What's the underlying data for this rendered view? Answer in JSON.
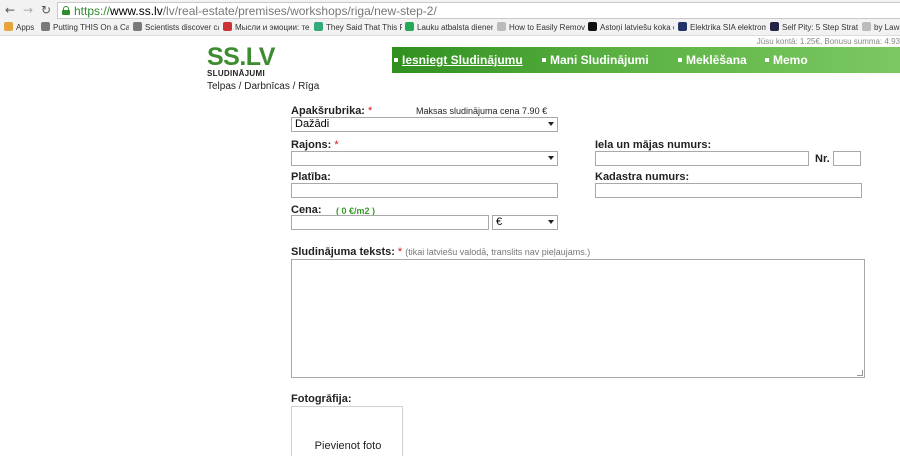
{
  "browser": {
    "url_scheme": "https://",
    "url_host": "www.ss.lv",
    "url_path": "/lv/real-estate/premises/workshops/riga/new-step-2/",
    "bookmarks": [
      {
        "label": "Apps",
        "color": "#e8a33d"
      },
      {
        "label": "Putting THIS On a Ca",
        "color": "#7a7a7a"
      },
      {
        "label": "Scientists discover ca",
        "color": "#7a7a7a"
      },
      {
        "label": "Мысли и эмоции: те",
        "color": "#c33"
      },
      {
        "label": "They Said That This F",
        "color": "#3a7"
      },
      {
        "label": "Lauku atbalsta diener",
        "color": "#2a5"
      },
      {
        "label": "How to Easily Remove",
        "color": "#bbb"
      },
      {
        "label": "Astoņi latviešu koka c",
        "color": "#111"
      },
      {
        "label": "Elektrika SIA elektrom",
        "color": "#236"
      },
      {
        "label": "Self Pity: 5 Step Strate",
        "color": "#224"
      },
      {
        "label": "by Lawn",
        "color": "#bbb"
      }
    ]
  },
  "account": {
    "text": "Jūsu kontā: 1.25€, Bonusu summa: 4.93"
  },
  "header": {
    "logo": "SS.LV",
    "logo_sub": "SLUDINĀJUMI",
    "nav": {
      "submit": "Iesniegt Sludinājumu",
      "my": "Mani Sludinājumi",
      "search": "Meklēšana",
      "memo": "Memo"
    }
  },
  "breadcrumb": "Telpas / Darbnīcas / Rīga",
  "form": {
    "subcategory_label": "Apakšrubrika:",
    "required_mark": "*",
    "price_note": "Maksas sludinājuma cena 7.90 €",
    "subcategory_value": "Dažādi",
    "district_label": "Rajons:",
    "district_value": "",
    "street_label": "Iela un mājas numurs:",
    "nr_label": "Nr.",
    "area_label": "Platība:",
    "cadastre_label": "Kadastra numurs:",
    "price_label": "Cena:",
    "price_per_m2": "( 0 €/m2 )",
    "currency_value": "€",
    "text_label": "Sludinājuma teksts:",
    "text_hint": "(tikai latviešu valodā, translits nav pieļaujams.)",
    "photo_label": "Fotogrāfija:",
    "add_photo": "Pievienot foto"
  }
}
